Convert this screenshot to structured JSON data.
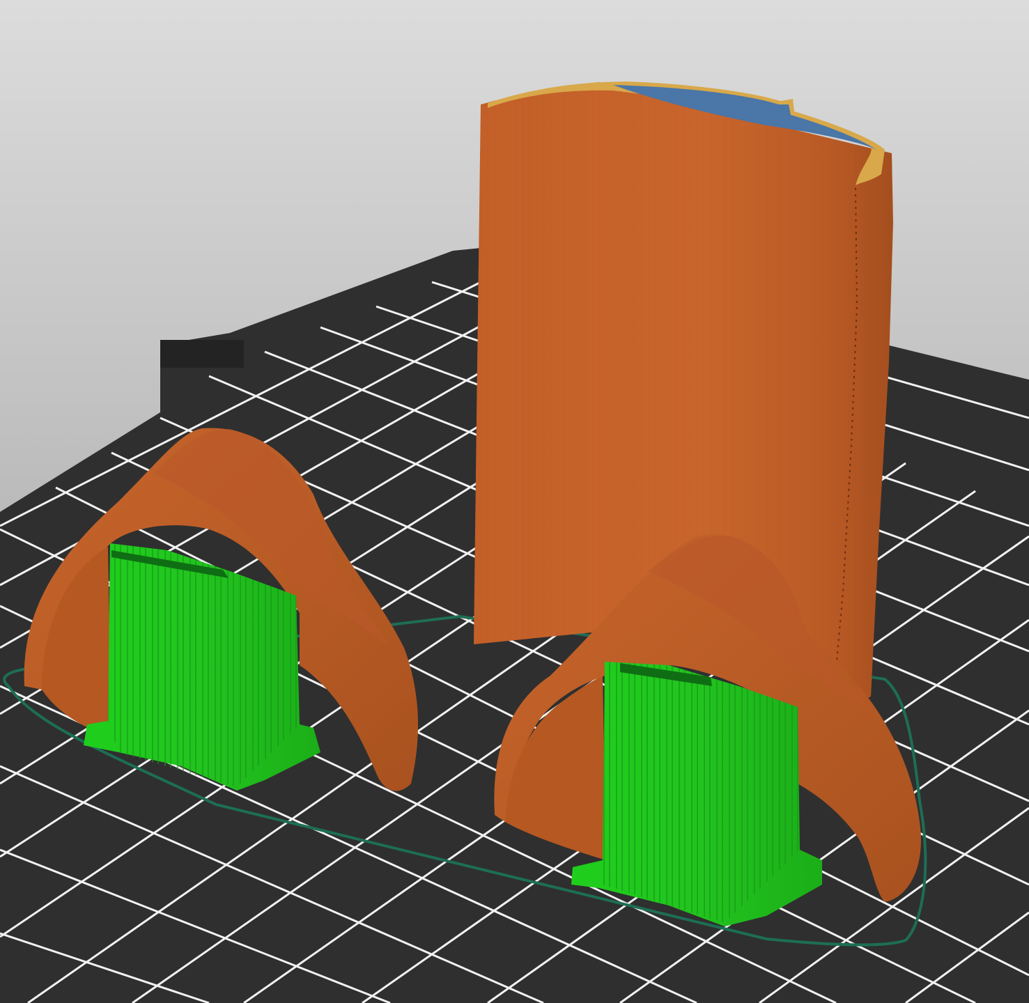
{
  "app": {
    "view": "slicer-preview-3d"
  },
  "scene": {
    "background_top": "#d8d8d8",
    "background_bottom": "#9e9e9e",
    "bed_color": "#2e2e2e",
    "bed_grid_color": "#ffffff",
    "objects": [
      {
        "name": "tall-sleeve-part",
        "perimeter_color": "#c8622a",
        "top_color": "#4a76a8"
      },
      {
        "name": "arch-shell-left",
        "perimeter_color": "#c8622a",
        "support_color": "#22c41e"
      },
      {
        "name": "arch-shell-right",
        "perimeter_color": "#c8622a",
        "support_color": "#22c41e"
      }
    ],
    "skirt_color": "#1d6e55"
  }
}
